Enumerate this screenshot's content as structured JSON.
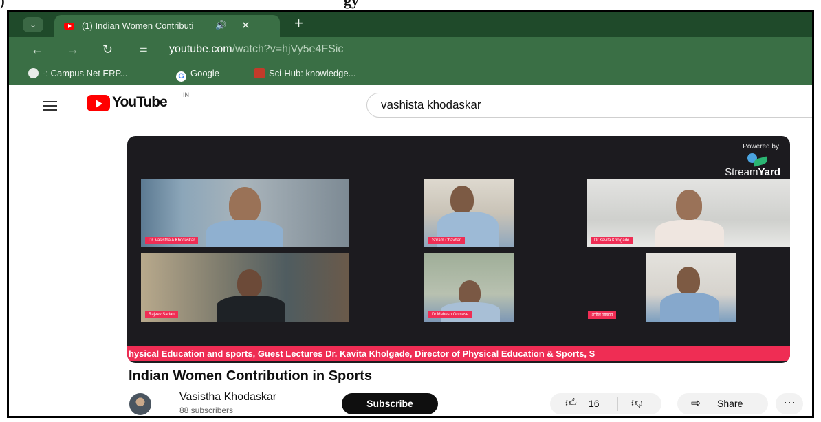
{
  "browser": {
    "tab_title": "(1) Indian Women Contributi",
    "tab_audio_icon": "speaker-icon",
    "url_site_icon": "site-settings-icon",
    "url_host": "youtube.com",
    "url_path": "/watch?v=hjVy5e4FSic",
    "bookmarks": [
      {
        "label": "-: Campus Net ERP...",
        "icon": "globe-icon"
      },
      {
        "label": "Google",
        "icon": "google-icon"
      },
      {
        "label": "Sci-Hub: knowledge...",
        "icon": "scihub-icon"
      }
    ]
  },
  "youtube": {
    "logo_text": "YouTube",
    "country_code": "IN",
    "search_value": "vashista khodaskar"
  },
  "video": {
    "powered_by": "Powered by",
    "streamyard": {
      "light": "Stream",
      "bold": "Yard"
    },
    "participants": [
      "Dr. Vasistha A Khodaskar",
      "Sriram Chavhan",
      "Dr.Kavita Kholgade",
      "Rajeev Sadan",
      "Dr.Mahesh Gomase",
      "अमोल जाखडा"
    ],
    "ticker": "hysical Education and sports, Guest Lectures Dr. Kavita Kholgade, Director of Physical Education & Sports, S",
    "title": "Indian Women Contribution in Sports"
  },
  "channel": {
    "name": "Vasistha Khodaskar",
    "subscribers": "88 subscribers",
    "subscribe_label": "Subscribe"
  },
  "actions": {
    "like_count": "16",
    "share_label": "Share",
    "more_label": "···"
  },
  "colors": {
    "chrome_dark": "#1f4a2a",
    "chrome": "#3a6f45",
    "accent": "#ef2d54",
    "youtube_red": "#ff0000"
  }
}
